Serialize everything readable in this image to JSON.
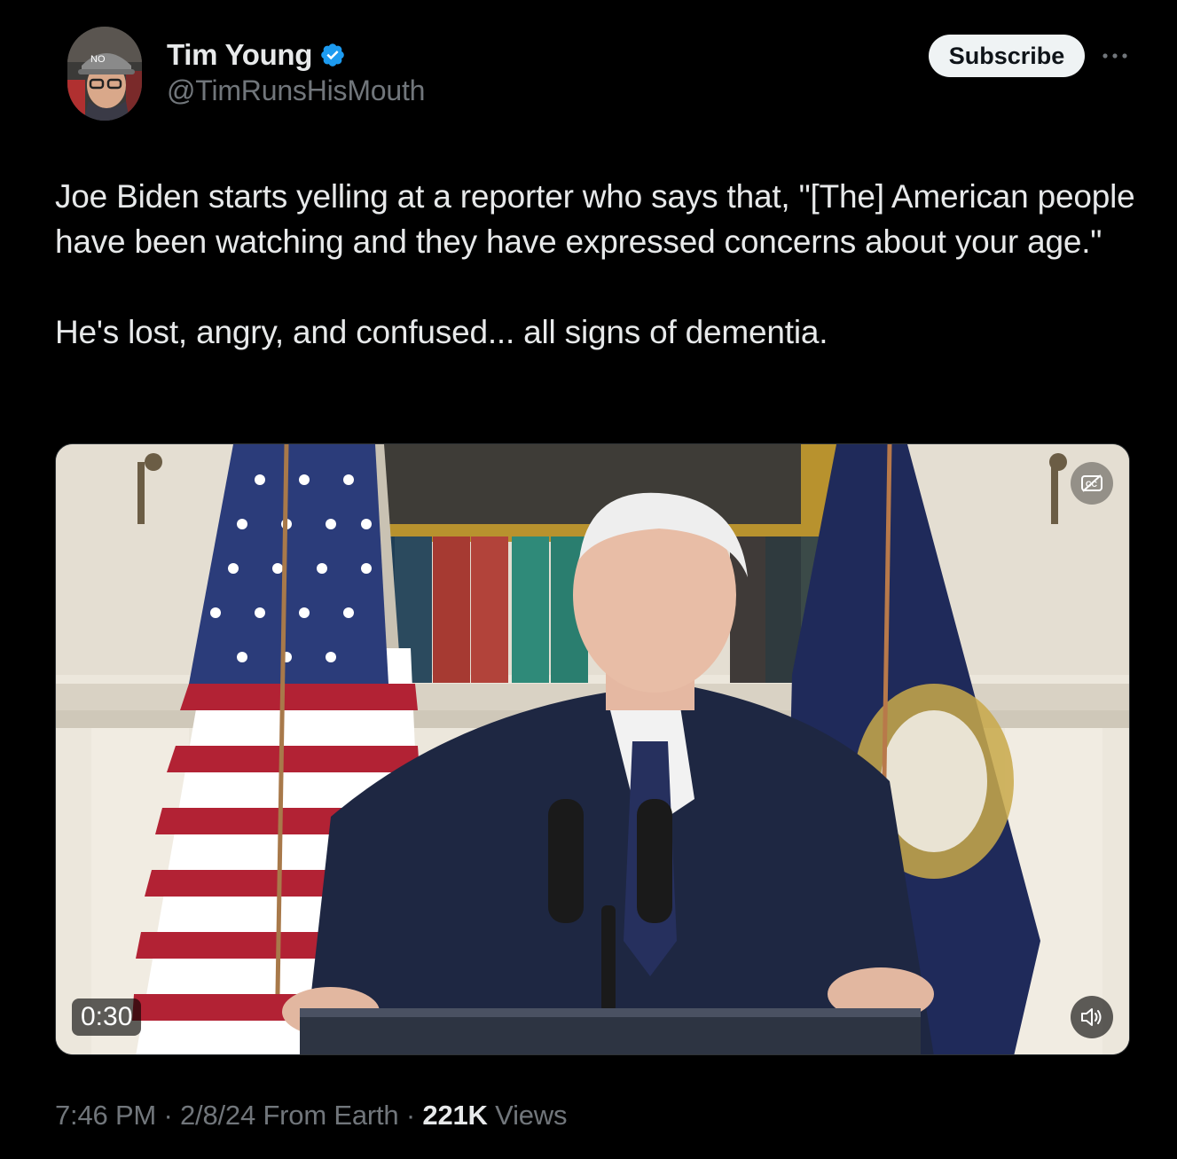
{
  "author": {
    "name": "Tim Young",
    "handle": "@TimRunsHisMouth",
    "verified": true,
    "avatar_icon": "profile-photo"
  },
  "actions": {
    "subscribe_label": "Subscribe",
    "more_icon": "more-dots-icon"
  },
  "tweet": {
    "paragraphs": [
      "Joe Biden starts yelling at a reporter who says that, \"[The] American people have been watching and they have expressed concerns about your age.\"",
      "He's lost, angry, and confused... all signs of dementia."
    ]
  },
  "media": {
    "type": "video",
    "duration": "0:30",
    "captions_icon": "captions-off-icon",
    "mute_icon": "speaker-muted-icon"
  },
  "meta": {
    "time": "7:46 PM",
    "separator": " · ",
    "date": "2/8/24",
    "source": "From Earth",
    "views_count": "221K",
    "views_label": " Views"
  },
  "colors": {
    "background": "#000000",
    "primary_text": "#e7e9ea",
    "secondary_text": "#71767b",
    "verified_blue": "#1d9bf0",
    "button_bg": "#eff3f4"
  }
}
